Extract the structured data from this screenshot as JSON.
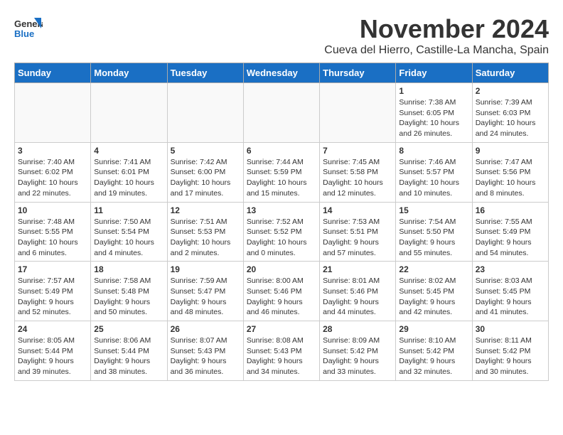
{
  "header": {
    "logo_general": "General",
    "logo_blue": "Blue",
    "month_title": "November 2024",
    "subtitle": "Cueva del Hierro, Castille-La Mancha, Spain"
  },
  "calendar": {
    "days_of_week": [
      "Sunday",
      "Monday",
      "Tuesday",
      "Wednesday",
      "Thursday",
      "Friday",
      "Saturday"
    ],
    "weeks": [
      [
        {
          "day": "",
          "info": ""
        },
        {
          "day": "",
          "info": ""
        },
        {
          "day": "",
          "info": ""
        },
        {
          "day": "",
          "info": ""
        },
        {
          "day": "",
          "info": ""
        },
        {
          "day": "1",
          "info": "Sunrise: 7:38 AM\nSunset: 6:05 PM\nDaylight: 10 hours and 26 minutes."
        },
        {
          "day": "2",
          "info": "Sunrise: 7:39 AM\nSunset: 6:03 PM\nDaylight: 10 hours and 24 minutes."
        }
      ],
      [
        {
          "day": "3",
          "info": "Sunrise: 7:40 AM\nSunset: 6:02 PM\nDaylight: 10 hours and 22 minutes."
        },
        {
          "day": "4",
          "info": "Sunrise: 7:41 AM\nSunset: 6:01 PM\nDaylight: 10 hours and 19 minutes."
        },
        {
          "day": "5",
          "info": "Sunrise: 7:42 AM\nSunset: 6:00 PM\nDaylight: 10 hours and 17 minutes."
        },
        {
          "day": "6",
          "info": "Sunrise: 7:44 AM\nSunset: 5:59 PM\nDaylight: 10 hours and 15 minutes."
        },
        {
          "day": "7",
          "info": "Sunrise: 7:45 AM\nSunset: 5:58 PM\nDaylight: 10 hours and 12 minutes."
        },
        {
          "day": "8",
          "info": "Sunrise: 7:46 AM\nSunset: 5:57 PM\nDaylight: 10 hours and 10 minutes."
        },
        {
          "day": "9",
          "info": "Sunrise: 7:47 AM\nSunset: 5:56 PM\nDaylight: 10 hours and 8 minutes."
        }
      ],
      [
        {
          "day": "10",
          "info": "Sunrise: 7:48 AM\nSunset: 5:55 PM\nDaylight: 10 hours and 6 minutes."
        },
        {
          "day": "11",
          "info": "Sunrise: 7:50 AM\nSunset: 5:54 PM\nDaylight: 10 hours and 4 minutes."
        },
        {
          "day": "12",
          "info": "Sunrise: 7:51 AM\nSunset: 5:53 PM\nDaylight: 10 hours and 2 minutes."
        },
        {
          "day": "13",
          "info": "Sunrise: 7:52 AM\nSunset: 5:52 PM\nDaylight: 10 hours and 0 minutes."
        },
        {
          "day": "14",
          "info": "Sunrise: 7:53 AM\nSunset: 5:51 PM\nDaylight: 9 hours and 57 minutes."
        },
        {
          "day": "15",
          "info": "Sunrise: 7:54 AM\nSunset: 5:50 PM\nDaylight: 9 hours and 55 minutes."
        },
        {
          "day": "16",
          "info": "Sunrise: 7:55 AM\nSunset: 5:49 PM\nDaylight: 9 hours and 54 minutes."
        }
      ],
      [
        {
          "day": "17",
          "info": "Sunrise: 7:57 AM\nSunset: 5:49 PM\nDaylight: 9 hours and 52 minutes."
        },
        {
          "day": "18",
          "info": "Sunrise: 7:58 AM\nSunset: 5:48 PM\nDaylight: 9 hours and 50 minutes."
        },
        {
          "day": "19",
          "info": "Sunrise: 7:59 AM\nSunset: 5:47 PM\nDaylight: 9 hours and 48 minutes."
        },
        {
          "day": "20",
          "info": "Sunrise: 8:00 AM\nSunset: 5:46 PM\nDaylight: 9 hours and 46 minutes."
        },
        {
          "day": "21",
          "info": "Sunrise: 8:01 AM\nSunset: 5:46 PM\nDaylight: 9 hours and 44 minutes."
        },
        {
          "day": "22",
          "info": "Sunrise: 8:02 AM\nSunset: 5:45 PM\nDaylight: 9 hours and 42 minutes."
        },
        {
          "day": "23",
          "info": "Sunrise: 8:03 AM\nSunset: 5:45 PM\nDaylight: 9 hours and 41 minutes."
        }
      ],
      [
        {
          "day": "24",
          "info": "Sunrise: 8:05 AM\nSunset: 5:44 PM\nDaylight: 9 hours and 39 minutes."
        },
        {
          "day": "25",
          "info": "Sunrise: 8:06 AM\nSunset: 5:44 PM\nDaylight: 9 hours and 38 minutes."
        },
        {
          "day": "26",
          "info": "Sunrise: 8:07 AM\nSunset: 5:43 PM\nDaylight: 9 hours and 36 minutes."
        },
        {
          "day": "27",
          "info": "Sunrise: 8:08 AM\nSunset: 5:43 PM\nDaylight: 9 hours and 34 minutes."
        },
        {
          "day": "28",
          "info": "Sunrise: 8:09 AM\nSunset: 5:42 PM\nDaylight: 9 hours and 33 minutes."
        },
        {
          "day": "29",
          "info": "Sunrise: 8:10 AM\nSunset: 5:42 PM\nDaylight: 9 hours and 32 minutes."
        },
        {
          "day": "30",
          "info": "Sunrise: 8:11 AM\nSunset: 5:42 PM\nDaylight: 9 hours and 30 minutes."
        }
      ]
    ]
  }
}
